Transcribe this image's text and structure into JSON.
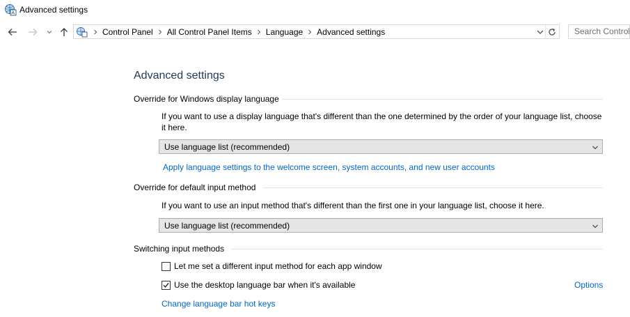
{
  "window": {
    "title": "Advanced settings",
    "icon": "language-globe-icon"
  },
  "nav": {
    "back": "back-arrow-icon",
    "forward": "forward-arrow-icon",
    "recent": "chevron-down-icon",
    "up": "up-arrow-icon"
  },
  "address": {
    "crumbs": [
      "Control Panel",
      "All Control Panel Items",
      "Language",
      "Advanced settings"
    ]
  },
  "search": {
    "placeholder": "Search Control"
  },
  "main": {
    "heading": "Advanced settings",
    "display_language": {
      "title": "Override for Windows display language",
      "description": "If you want to use a display language that's different than the one determined by the order of your language list, choose it here.",
      "selected": "Use language list (recommended)",
      "link": "Apply language settings to the welcome screen, system accounts, and new user accounts"
    },
    "input_method": {
      "title": "Override for default input method",
      "description": "If you want to use an input method that's different than the first one in your language list, choose it here.",
      "selected": "Use language list (recommended)"
    },
    "switching": {
      "title": "Switching input methods",
      "per_app_label": "Let me set a different input method for each app window",
      "per_app_checked": false,
      "language_bar_label": "Use the desktop language bar when it's available",
      "language_bar_checked": true,
      "options_link": "Options",
      "hotkeys_link": "Change language bar hot keys"
    }
  },
  "colors": {
    "heading": "#1e395b",
    "link": "#0066cc"
  }
}
